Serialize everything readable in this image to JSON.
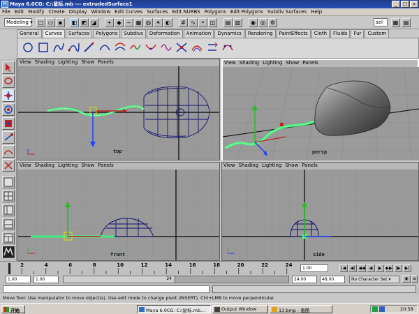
{
  "window": {
    "title": "Maya 6.0CG: C:\\鼠标.mb --- extrudedSurface1",
    "icon": "maya-icon"
  },
  "menu": [
    "File",
    "Edit",
    "Modify",
    "Create",
    "Display",
    "Window",
    "Edit Curves",
    "Surfaces",
    "Edit NURBS",
    "Polygons",
    "Edit Polygons",
    "Subdiv Surfaces",
    "Help"
  ],
  "status": {
    "menuset": "Modeling",
    "selection_mask": "sel"
  },
  "shelf": {
    "tabs": [
      "General",
      "Curves",
      "Surfaces",
      "Polygons",
      "Subdivs",
      "Deformation",
      "Animation",
      "Dynamics",
      "Rendering",
      "PaintEffects",
      "Cloth",
      "Fluids",
      "Fur",
      "Custom"
    ],
    "active_tab": "Curves"
  },
  "viewport_menu": [
    "View",
    "Shading",
    "Lighting",
    "Show",
    "Panels"
  ],
  "viewports": {
    "top": {
      "camera": "top"
    },
    "persp": {
      "camera": "persp"
    },
    "front": {
      "camera": "front"
    },
    "side": {
      "camera": "side"
    }
  },
  "timeline": {
    "ticks": [
      "2",
      "4",
      "6",
      "8",
      "10",
      "12",
      "14",
      "16",
      "18",
      "20",
      "22",
      "24"
    ],
    "current_frame": "1.00"
  },
  "range": {
    "start": "1.00",
    "playback_start": "1.00",
    "slider_label": "24",
    "playback_end": "24.00",
    "end": "48.00",
    "character_set": "No Character Set"
  },
  "helpline": "Move Tool: Use manipulator to move object(s). Use edit mode to change pivot (INSERT). Ctrl+LMB to move perpendicular.",
  "taskbar": {
    "start": "开始",
    "tasks": [
      "Maya 6.0CG: C:\\鼠标.mb...",
      "Output Window",
      "13.bmp - 画图"
    ],
    "clock": "20:58"
  },
  "colors": {
    "titlebar": "#2850b4",
    "grid": "#8c8c8c",
    "viewport_bg": "#9a9a9a",
    "curve": "#40ff80",
    "wire": "#101070"
  }
}
